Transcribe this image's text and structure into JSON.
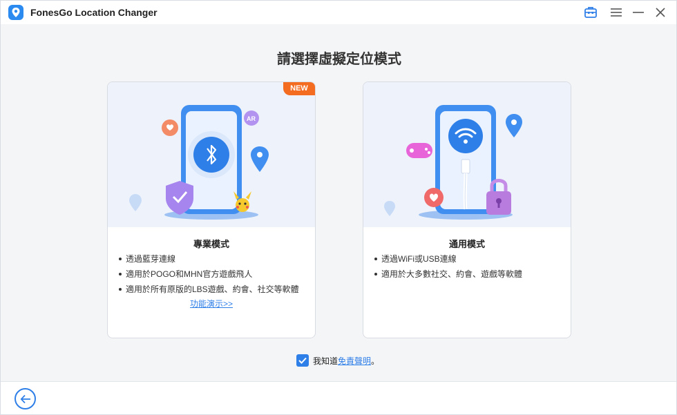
{
  "window": {
    "title": "FonesGo Location Changer",
    "icons": [
      "location-pin-icon",
      "toolbox-icon",
      "menu-icon",
      "minimize-icon",
      "close-icon"
    ]
  },
  "page": {
    "title": "請選擇虛擬定位模式"
  },
  "modes": [
    {
      "badge": "NEW",
      "title": "專業模式",
      "features": [
        "透過藍芽連線",
        "適用於POGO和MHN官方遊戲飛人",
        "適用於所有原版的LBS遊戲、約會、社交等軟體"
      ],
      "demo_link": "功能演示>>",
      "illustration": "bluetooth-phone"
    },
    {
      "title": "通用模式",
      "features": [
        "透過WiFi或USB連線",
        "適用於大多數社交、約會、遊戲等軟體"
      ],
      "illustration": "wifi-usb-phone"
    }
  ],
  "agreement": {
    "checked": true,
    "label": "我知道",
    "link": "免責聲明",
    "suffix": "。"
  },
  "colors": {
    "accent": "#2f7fe8",
    "badge": "#f36c20",
    "background": "#f4f5f7"
  }
}
